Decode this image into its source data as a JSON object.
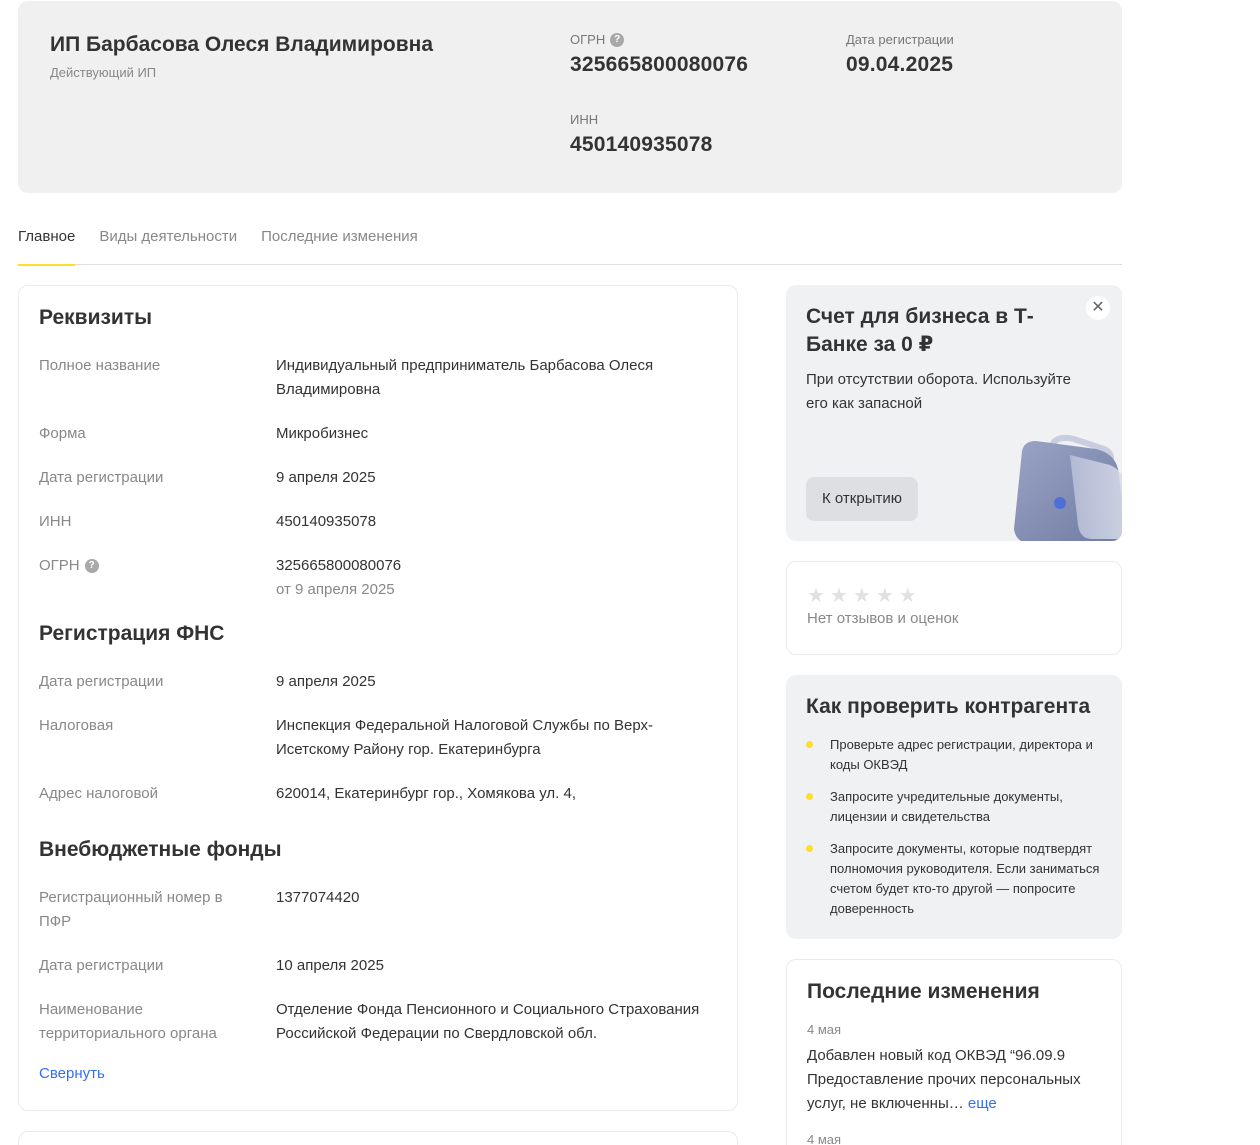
{
  "header": {
    "name": "ИП Барбасова Олеся Владимировна",
    "status": "Действующий ИП",
    "ogrn_label": "ОГРН",
    "ogrn_value": "325665800080076",
    "reg_date_label": "Дата регистрации",
    "reg_date_value": "09.04.2025",
    "inn_label": "ИНН",
    "inn_value": "450140935078"
  },
  "tabs": [
    {
      "label": "Главное",
      "active": true
    },
    {
      "label": "Виды деятельности",
      "active": false
    },
    {
      "label": "Последние изменения",
      "active": false
    }
  ],
  "details": {
    "requisites": {
      "title": "Реквизиты",
      "full_name_label": "Полное название",
      "full_name_value": "Индивидуальный предприниматель Барбасова Олеся Владимировна",
      "form_label": "Форма",
      "form_value": "Микробизнес",
      "reg_date_label": "Дата регистрации",
      "reg_date_value": "9 апреля 2025",
      "inn_label": "ИНН",
      "inn_value": "450140935078",
      "ogrn_label": "ОГРН",
      "ogrn_value": "325665800080076",
      "ogrn_date": "от 9 апреля 2025"
    },
    "fns": {
      "title": "Регистрация ФНС",
      "reg_date_label": "Дата регистрации",
      "reg_date_value": "9 апреля 2025",
      "tax_label": "Налоговая",
      "tax_value": "Инспекция Федеральной Налоговой Службы по Верх-Исетскому Району гор. Екатеринбурга",
      "tax_address_label": "Адрес налоговой",
      "tax_address_value": "620014, Екатеринбург гор., Хомякова ул. 4,"
    },
    "funds": {
      "title": "Внебюджетные фонды",
      "pfr_number_label": "Регистрационный номер в ПФР",
      "pfr_number_value": "1377074420",
      "reg_date_label": "Дата регистрации",
      "reg_date_value": "10 апреля 2025",
      "org_label": "Наименование территориального органа",
      "org_value": "Отделение Фонда Пенсионного и Социального Страхования Российской Федерации по Свердловской обл."
    },
    "collapse_label": "Свернуть"
  },
  "promo": {
    "title": "Счет для бизнеса в Т-Банке за 0 ₽",
    "text": "При отсутствии оборота. Используйте его как запасной",
    "button": "К открытию",
    "close_glyph": "✕"
  },
  "rating": {
    "stars": 0,
    "star_glyph": "★",
    "text": "Нет отзывов и оценок"
  },
  "check": {
    "title": "Как проверить контрагента",
    "items": [
      "Проверьте адрес регистрации, директора и коды ОКВЭД",
      "Запросите учредительные документы, лицензии и свидетельства",
      "Запросите документы, которые подтвердят полномочия руководителя. Если заниматься счетом будет кто-то другой — попросите доверенность"
    ]
  },
  "changes": {
    "title": "Последние изменения",
    "items": [
      {
        "date": "4 мая",
        "text": "Добавлен новый код ОКВЭД “96.09.9 Предоставление прочих персональных услуг, не включенны…",
        "more": "еще"
      },
      {
        "date": "4 мая"
      }
    ]
  },
  "colors": {
    "accent_yellow": "#ffdd2d",
    "link_blue": "#336fee",
    "card_gray": "#f0f0f0"
  }
}
